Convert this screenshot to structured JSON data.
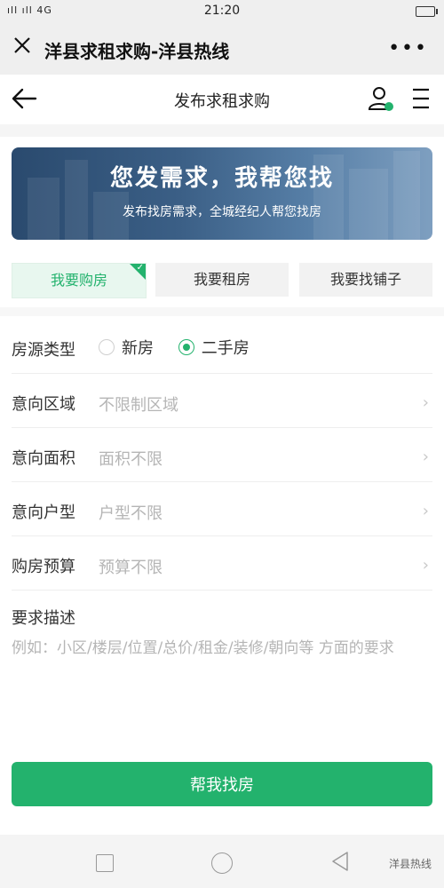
{
  "status_bar": {
    "signal_text": "ıll ıll 4G",
    "time": "21:20"
  },
  "wechat_bar": {
    "title": "洋县求租求购-洋县热线",
    "more": "•••"
  },
  "nav": {
    "title": "发布求租求购"
  },
  "banner": {
    "headline": "您发需求，我帮您找",
    "subline": "发布找房需求，全城经纪人帮您找房"
  },
  "tabs": [
    {
      "label": "我要购房",
      "active": true
    },
    {
      "label": "我要租房",
      "active": false
    },
    {
      "label": "我要找铺子",
      "active": false
    }
  ],
  "form": {
    "property_type": {
      "label": "房源类型",
      "options": [
        {
          "label": "新房",
          "selected": false
        },
        {
          "label": "二手房",
          "selected": true
        }
      ]
    },
    "rows": [
      {
        "label": "意向区域",
        "value": "不限制区域"
      },
      {
        "label": "意向面积",
        "value": "面积不限"
      },
      {
        "label": "意向户型",
        "value": "户型不限"
      },
      {
        "label": "购房预算",
        "value": "预算不限"
      }
    ],
    "description": {
      "label": "要求描述",
      "placeholder": "例如：小区/楼层/位置/总价/租金/装修/朝向等 方面的要求"
    }
  },
  "submit_label": "帮我找房",
  "watermark": "洋县热线",
  "colors": {
    "accent": "#23b26d",
    "banner": "#3b5f86"
  }
}
